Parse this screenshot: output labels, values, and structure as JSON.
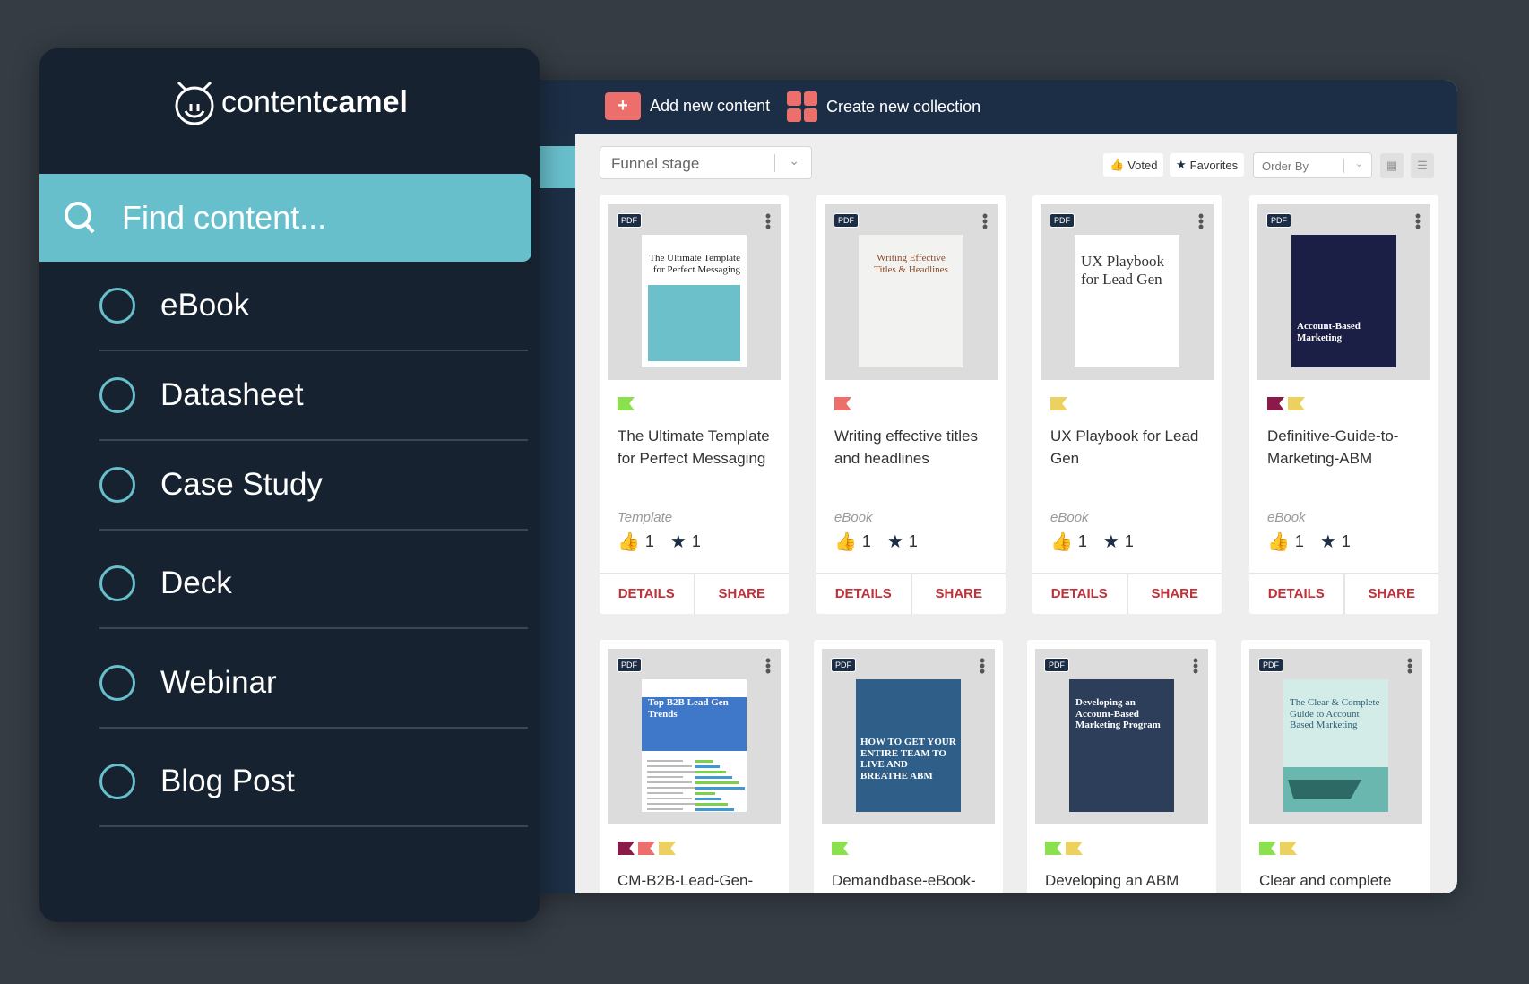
{
  "colors": {
    "accent": "#68bfcc",
    "navy": "#1c2e45",
    "coral": "#ec6f6c",
    "action": "#c0313a",
    "green": "#8be04e",
    "red": "#ec6f6c",
    "yellow": "#ecd060",
    "maroon": "#8b1a48"
  },
  "sidebar": {
    "logo": {
      "light": "content",
      "bold": "camel",
      "icon": "camel-icon"
    },
    "search": {
      "placeholder": "Find content...",
      "icon": "search-icon"
    },
    "items": [
      {
        "label": "eBook"
      },
      {
        "label": "Datasheet"
      },
      {
        "label": "Case Study"
      },
      {
        "label": "Deck"
      },
      {
        "label": "Webinar"
      },
      {
        "label": "Blog Post"
      }
    ]
  },
  "header": {
    "add_label": "Add new content",
    "collection_label": "Create new collection"
  },
  "toolbar": {
    "funnel_placeholder": "Funnel stage",
    "voted": "Voted",
    "favorites": "Favorites",
    "order_by": "Order By"
  },
  "cards": [
    {
      "title": "The Ultimate Template for Perfect Messaging",
      "type": "Template",
      "votes": "1",
      "favs": "1",
      "flags": [
        "green"
      ],
      "cover": "The Ultimate Template for Perfect Messaging",
      "style": "teal"
    },
    {
      "title": "Writing effective titles and headlines",
      "type": "eBook",
      "votes": "1",
      "favs": "1",
      "flags": [
        "red"
      ],
      "cover": "Writing Effective Titles & Headlines",
      "style": "light"
    },
    {
      "title": "UX Playbook for Lead Gen",
      "type": "eBook",
      "votes": "1",
      "favs": "1",
      "flags": [
        "yellow"
      ],
      "cover": "UX Playbook for Lead Gen",
      "style": "white"
    },
    {
      "title": "Definitive-Guide-to-Marketing-ABM",
      "type": "eBook",
      "votes": "1",
      "favs": "1",
      "flags": [
        "maroon",
        "yellow"
      ],
      "cover": "Account-Based Marketing",
      "style": "dark"
    },
    {
      "title": "CM-B2B-Lead-Gen-",
      "type": "",
      "votes": "",
      "favs": "",
      "flags": [
        "maroon",
        "red",
        "yellow"
      ],
      "cover": "Top B2B Lead Gen Trends",
      "style": "report"
    },
    {
      "title": "Demandbase-eBook-",
      "type": "",
      "votes": "",
      "favs": "",
      "flags": [
        "green"
      ],
      "cover": "HOW TO GET YOUR ENTIRE TEAM TO LIVE AND BREATHE ABM",
      "style": "blue"
    },
    {
      "title": "Developing an ABM",
      "type": "",
      "votes": "",
      "favs": "",
      "flags": [
        "green",
        "yellow"
      ],
      "cover": "Developing an Account-Based Marketing Program",
      "style": "photo"
    },
    {
      "title": "Clear and complete",
      "type": "",
      "votes": "",
      "favs": "",
      "flags": [
        "green",
        "yellow"
      ],
      "cover": "The Clear & Complete Guide to Account Based Marketing",
      "style": "sea"
    }
  ],
  "card_labels": {
    "pdf": "PDF",
    "details": "DETAILS",
    "share": "SHARE"
  }
}
